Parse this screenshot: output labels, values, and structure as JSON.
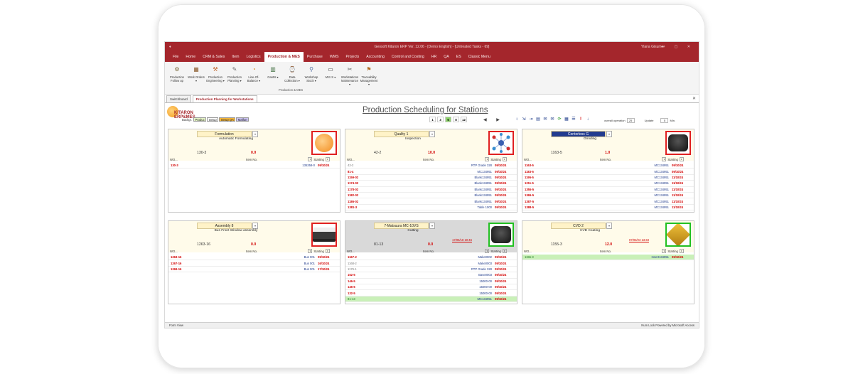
{
  "window": {
    "title": "Geosoft Kitaron ERP Ver. 12.06 - [Demo English] - [Untreated Tasks - 69]",
    "user": "Ylana Gisumer",
    "controls": "— ▢ ✕"
  },
  "menu": [
    "File",
    "Home",
    "CRM & Sales",
    "Item",
    "Logistics",
    "Production & MES",
    "Purchase",
    "WMS",
    "Projects",
    "Accounting",
    "Control and Costing",
    "HR",
    "QA",
    "ES",
    "Classic Menu"
  ],
  "ribbon": {
    "buttons": [
      {
        "label": "Production Follow up",
        "icon": "factory-icon",
        "color": "#7a6a3a"
      },
      {
        "label": "Work Orders ▾",
        "icon": "clipboard-icon",
        "color": "#8a5a2a"
      },
      {
        "label": "Production Engineering ▾",
        "icon": "engineering-icon",
        "color": "#c2652a"
      },
      {
        "label": "Production Planning ▾",
        "icon": "planning-icon",
        "color": "#6a6a6a"
      },
      {
        "label": "Line-Of-Balance ▾",
        "icon": "balance-icon",
        "color": "#d88a20"
      },
      {
        "label": "Gantts ▾",
        "icon": "gantt-icon",
        "color": "#3a6a3a"
      },
      {
        "label": "Data Collection ▾",
        "icon": "data-collection-icon",
        "color": "#d88a20"
      },
      {
        "label": "Workshop Stock ▾",
        "icon": "workshop-icon",
        "color": "#4a6aa0"
      },
      {
        "label": "M.E.S ▾",
        "icon": "monitor-icon",
        "color": "#333333"
      },
      {
        "label": "Workstations Maintenance ▾",
        "icon": "tools-icon",
        "color": "#555555"
      },
      {
        "label": "Traceability Management ▾",
        "icon": "traceability-icon",
        "color": "#b06a20"
      }
    ],
    "group_label": "Production & MES"
  },
  "tabs": [
    {
      "label": "Switchboard"
    },
    {
      "label": "Production Planning for Workstations"
    }
  ],
  "form": {
    "logo_line1": "KITARON",
    "logo_line2": "ERP&MES",
    "background_label": "Backgr.",
    "background_chips": [
      "Produc",
      "Setup",
      "Setup QA",
      "Malfun"
    ],
    "title": "Production Scheduling for Stations",
    "pages": [
      "1",
      "3",
      "6",
      "8",
      "12"
    ],
    "selected_page": "6",
    "overall_operation_label": "overall operation",
    "overall_operation_value": "25",
    "update_label": "Update",
    "update_value": "5",
    "update_unit": "Min."
  },
  "panels": [
    {
      "station": "Formulation",
      "description": "Automatic Formulating",
      "order": "130-3",
      "qty": "0.0",
      "date": "",
      "image": "formulation-image",
      "image_border": "red",
      "header_style": "yellow",
      "headers": [
        "WO...",
        "Item No.",
        "Starting"
      ],
      "rows": [
        {
          "wo": "130-3",
          "item": "135358-0",
          "start": "09/10/24",
          "done": false
        }
      ]
    },
    {
      "station": "Quality 1",
      "description": "Inspection",
      "order": "42-2",
      "qty": "10.0",
      "date": "",
      "image": "quality-image",
      "image_border": "red",
      "header_style": "yellow",
      "headers": [
        "WO...",
        "Item No.",
        "Starting"
      ],
      "rows": [
        {
          "wo": "42-2",
          "item": "RTP Grade 328",
          "start": "09/10/24",
          "done": false,
          "grey": true
        },
        {
          "wo": "81-4",
          "item": "MC134951",
          "start": "09/10/24",
          "done": false
        },
        {
          "wo": "1159-02",
          "item": "Blank134951",
          "start": "09/10/24",
          "done": false
        },
        {
          "wo": "1174-02",
          "item": "Blank134951",
          "start": "09/10/24",
          "done": false
        },
        {
          "wo": "1178-02",
          "item": "Blank134951",
          "start": "09/10/24",
          "done": false
        },
        {
          "wo": "1182-02",
          "item": "Blank134951",
          "start": "09/10/24",
          "done": false
        },
        {
          "wo": "1186-02",
          "item": "Blank134951",
          "start": "09/10/24",
          "done": false
        },
        {
          "wo": "1381-3",
          "item": "Table 1000",
          "start": "09/10/24",
          "done": false
        }
      ]
    },
    {
      "station": "Centerless G",
      "description": "Grinding",
      "order": "1163-5",
      "qty": "1.0",
      "date": "",
      "image": "grinding-image",
      "image_border": "red",
      "header_style": "yellow",
      "highlight_name": true,
      "headers": [
        "WO...",
        "Item No.",
        "Starting"
      ],
      "rows": [
        {
          "wo": "1163-5",
          "item": "MC134951",
          "start": "09/10/24",
          "done": false
        },
        {
          "wo": "1183-5",
          "item": "MC134951",
          "start": "09/10/24",
          "done": false
        },
        {
          "wo": "1195-5",
          "item": "MC134951",
          "start": "11/10/24",
          "done": false
        },
        {
          "wo": "1211-5",
          "item": "MC134951",
          "start": "11/10/24",
          "done": false
        },
        {
          "wo": "1355-5",
          "item": "MC134951",
          "start": "11/10/24",
          "done": false
        },
        {
          "wo": "1365-5",
          "item": "MC134951",
          "start": "11/10/24",
          "done": false
        },
        {
          "wo": "1387-5",
          "item": "MC134951",
          "start": "11/10/24",
          "done": false
        },
        {
          "wo": "1388-5",
          "item": "MC134951",
          "start": "11/10/24",
          "done": false
        }
      ]
    },
    {
      "station": "Assembly 8",
      "description": "Bus Front Window assembly",
      "order": "1263-16",
      "qty": "0.0",
      "date": "",
      "image": "bus-image",
      "image_border": "red",
      "header_style": "yellow",
      "headers": [
        "WO...",
        "Item No.",
        "Starting"
      ],
      "rows": [
        {
          "wo": "1263-16",
          "item": "Bus 001",
          "start": "09/10/24",
          "done": false
        },
        {
          "wo": "1267-16",
          "item": "Bus 001",
          "start": "16/10/24",
          "done": false
        },
        {
          "wo": "1269-16",
          "item": "Bus 001",
          "start": "17/10/24",
          "done": false
        }
      ]
    },
    {
      "station": "7-Matsuura MC-10VS",
      "description": "Cutting",
      "order": "81-13",
      "qty": "0.0",
      "date": "17/05/18 10:46",
      "image": "cnc-image",
      "image_border": "green",
      "header_style": "grey",
      "headers": [
        "WO...",
        "Item No.",
        "Starting"
      ],
      "rows": [
        {
          "wo": "1167-2",
          "item": "Make0002",
          "start": "09/10/24",
          "done": false
        },
        {
          "wo": "1168-2",
          "item": "Make0003",
          "start": "09/10/24",
          "done": false,
          "grey": true
        },
        {
          "wo": "1176-1",
          "item": "RTP Grade 328",
          "start": "09/10/24",
          "done": false,
          "grey": true
        },
        {
          "wo": "152-5",
          "item": "Base0003",
          "start": "09/10/24",
          "done": false
        },
        {
          "wo": "146-5",
          "item": "15000-00",
          "start": "09/10/24",
          "done": false
        },
        {
          "wo": "146-6",
          "item": "15000-00",
          "start": "09/10/24",
          "done": false
        },
        {
          "wo": "132-5",
          "item": "15000-00",
          "start": "09/10/24",
          "done": false
        },
        {
          "wo": "81-13",
          "item": "MC134951",
          "start": "09/10/24",
          "done": true
        }
      ]
    },
    {
      "station": "CVD 2",
      "description": "CVD Coating",
      "order": "1155-3",
      "qty": "12.0",
      "date": "07/03/23 13:33",
      "image": "cvd-image",
      "image_border": "green",
      "header_style": "yellow",
      "headers": [
        "WO...",
        "Item No.",
        "Starting"
      ],
      "rows": [
        {
          "wo": "1155-3",
          "item": "Insert134951",
          "start": "09/10/24",
          "done": true
        }
      ]
    }
  ],
  "status": {
    "left": "Form View",
    "right": "Num Lock   Powered by Microsoft Access"
  },
  "colors": {
    "brand": "#a4262c",
    "late": "#d20000",
    "done": "#c9f0b8"
  }
}
